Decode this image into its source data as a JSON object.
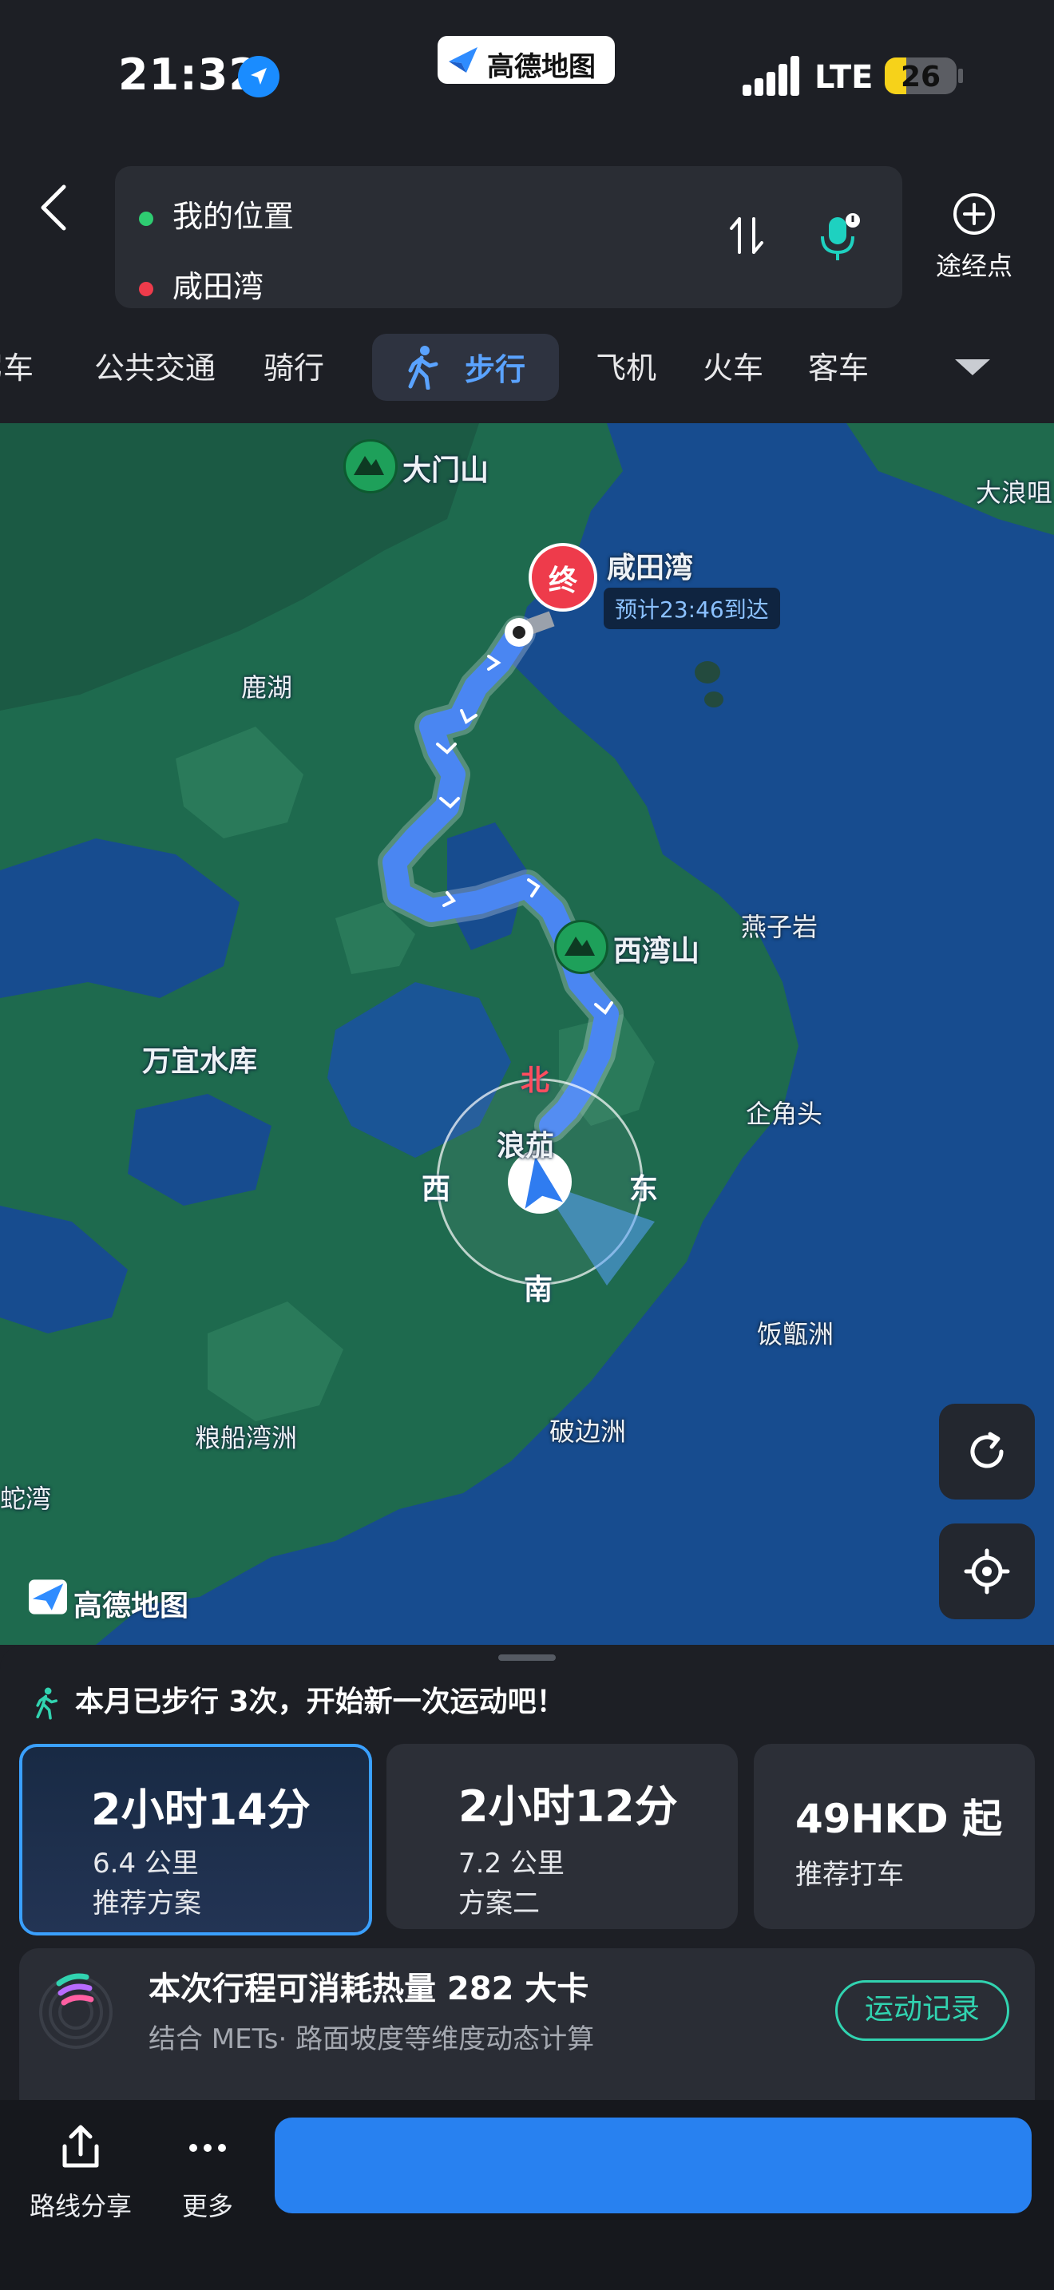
{
  "status_bar": {
    "time": "21:32",
    "brand": "高德地图",
    "network": "LTE",
    "battery": "26",
    "battery_level": 0.26,
    "location_icon": "location-arrow-icon"
  },
  "route": {
    "origin": "我的位置",
    "destination": "咸田湾",
    "waypoint_label": "途经点",
    "origin_color": "#2ecc71",
    "destination_color": "#ee3b4b"
  },
  "modes": {
    "tabs": [
      "驾车",
      "公共交通",
      "骑行",
      "步行",
      "飞机",
      "火车",
      "客车"
    ],
    "active": "步行",
    "accent": "#5aa3ff"
  },
  "map": {
    "labels": {
      "damenshan": "大门山",
      "dalangzui": "大浪咀",
      "xiantianwan": "咸田湾",
      "eta": "预计23:46到达",
      "luhu": "鹿湖",
      "yanziyan": "燕子岩",
      "xiwanshan": "西湾山",
      "wanyi": "万宜水库",
      "langjia": "浪茄",
      "qijiaotou": "企角头",
      "fanzengzhou": "饭甑洲",
      "liangchuanwanzhou": "粮船湾洲",
      "pobianzhou": "破边洲",
      "shewan": "蛇湾"
    },
    "end_marker": "终",
    "compass": {
      "north": "北",
      "south": "南",
      "east": "东",
      "west": "西"
    },
    "logo": "高德地图",
    "route_color": "#4a86f2"
  },
  "panel": {
    "tip": "本月已步行 3次，开始新一次运动吧！",
    "plans": [
      {
        "duration": "2小时14分",
        "distance": "6.4 公里",
        "label": "推荐方案",
        "selected": true
      },
      {
        "duration": "2小时12分",
        "distance": "7.2 公里",
        "label": "方案二",
        "selected": false
      }
    ],
    "taxi": {
      "price": "49HKD 起",
      "label": "推荐打车"
    },
    "calories": {
      "title": "本次行程可消耗热量 282 大卡",
      "subtitle": "结合 METs· 路面坡度等维度动态计算",
      "button": "运动记录"
    }
  },
  "bottom_bar": {
    "share": "路线分享",
    "more": "更多"
  }
}
